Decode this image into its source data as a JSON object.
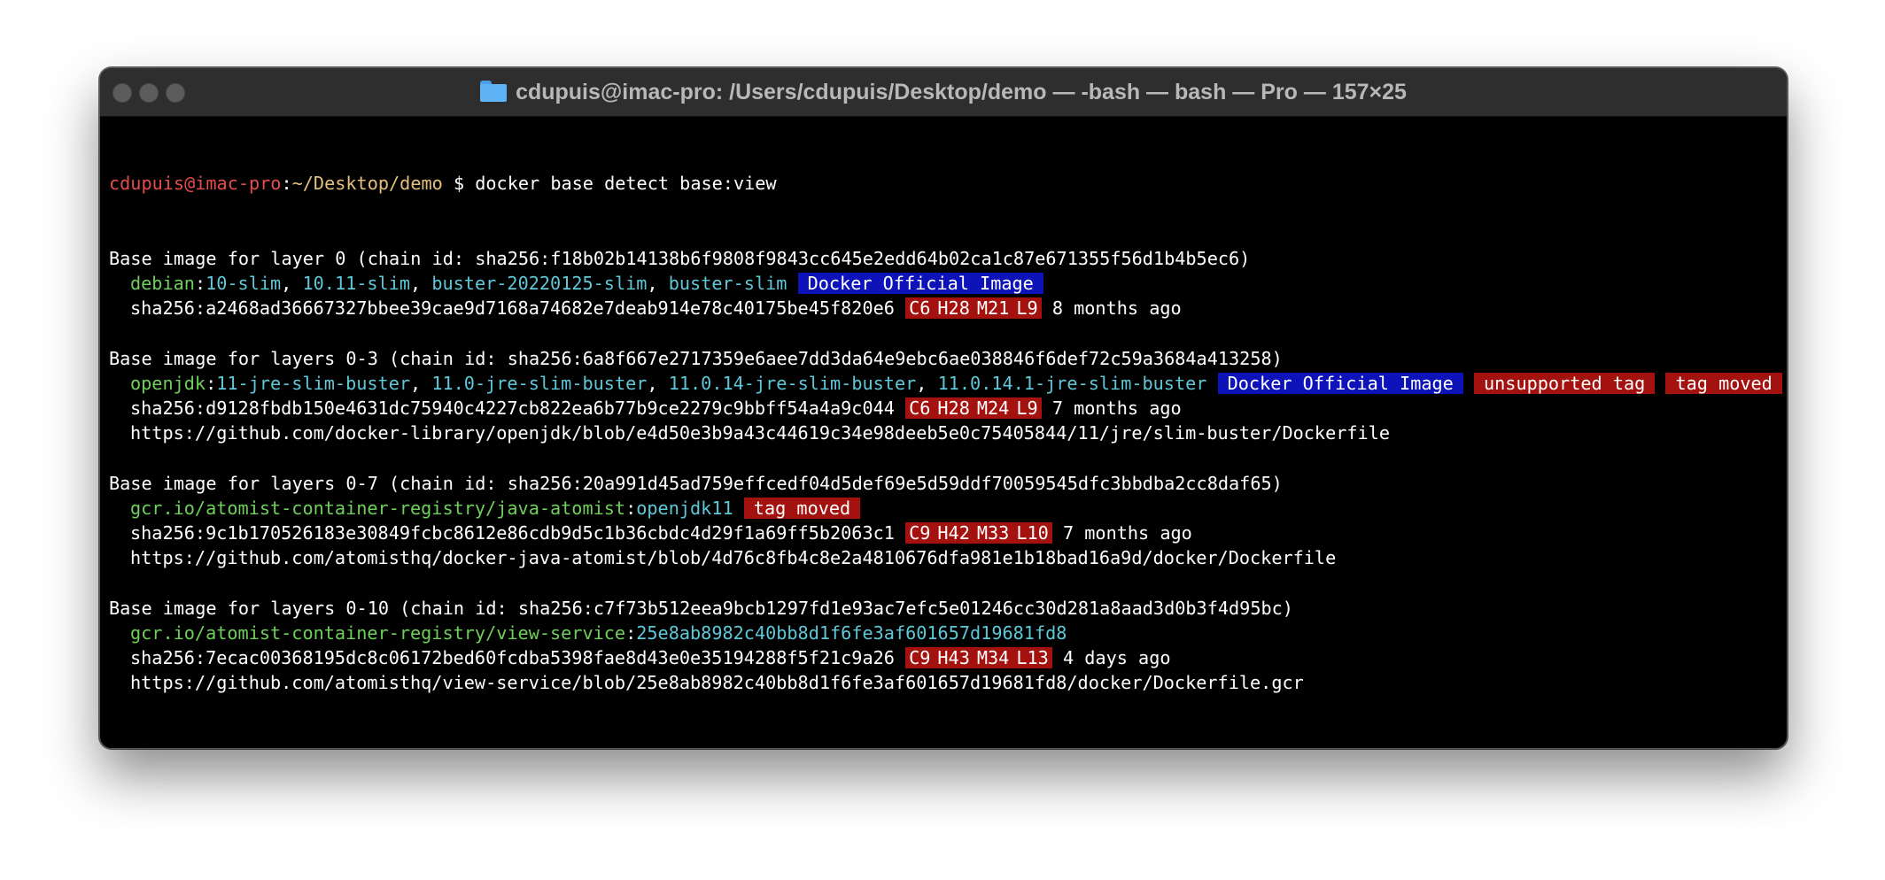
{
  "window": {
    "title": "cdupuis@imac-pro: /Users/cdupuis/Desktop/demo — -bash — bash — Pro — 157×25",
    "folder_icon": "folder-icon",
    "traffic_light_color": "#5c5c5c"
  },
  "prompt": {
    "user": "cdupuis@imac-pro",
    "path": "~/Desktop/demo",
    "symbol": "$",
    "command": "docker base detect base:view"
  },
  "blocks": [
    {
      "header": "Base image for layer 0 (chain id: sha256:f18b02b14138b6f9808f9843cc645e2edd64b02ca1c87e671355f56d1b4b5ec6)",
      "repo": "debian",
      "tags": [
        "10-slim",
        "10.11-slim",
        "buster-20220125-slim",
        "buster-slim"
      ],
      "badges": [
        {
          "label": "Docker Official Image",
          "type": "blue"
        }
      ],
      "digest": "sha256:a2468ad36667327bbee39cae9d7168a74682e7deab914e78c40175be45f820e6",
      "scores": [
        "C6",
        "H28",
        "M21",
        "L9"
      ],
      "age": "8 months ago",
      "url": ""
    },
    {
      "header": "Base image for layers 0-3 (chain id: sha256:6a8f667e2717359e6aee7dd3da64e9ebc6ae038846f6def72c59a3684a413258)",
      "repo": "openjdk",
      "tags": [
        "11-jre-slim-buster",
        "11.0-jre-slim-buster",
        "11.0.14-jre-slim-buster",
        "11.0.14.1-jre-slim-buster"
      ],
      "badges": [
        {
          "label": "Docker Official Image",
          "type": "blue"
        },
        {
          "label": "unsupported tag",
          "type": "red"
        },
        {
          "label": "tag moved",
          "type": "red"
        }
      ],
      "digest": "sha256:d9128fbdb150e4631dc75940c4227cb822ea6b77b9ce2279c9bbff54a4a9c044",
      "scores": [
        "C6",
        "H28",
        "M24",
        "L9"
      ],
      "age": "7 months ago",
      "url": "https://github.com/docker-library/openjdk/blob/e4d50e3b9a43c44619c34e98deeb5e0c75405844/11/jre/slim-buster/Dockerfile"
    },
    {
      "header": "Base image for layers 0-7 (chain id: sha256:20a991d45ad759effcedf04d5def69e5d59ddf70059545dfc3bbdba2cc8daf65)",
      "repo": "gcr.io/atomist-container-registry/java-atomist",
      "tags": [
        "openjdk11"
      ],
      "badges": [
        {
          "label": "tag moved",
          "type": "red"
        }
      ],
      "digest": "sha256:9c1b170526183e30849fcbc8612e86cdb9d5c1b36cbdc4d29f1a69ff5b2063c1",
      "scores": [
        "C9",
        "H42",
        "M33",
        "L10"
      ],
      "age": "7 months ago",
      "url": "https://github.com/atomisthq/docker-java-atomist/blob/4d76c8fb4c8e2a4810676dfa981e1b18bad16a9d/docker/Dockerfile"
    },
    {
      "header": "Base image for layers 0-10 (chain id: sha256:c7f73b512eea9bcb1297fd1e93ac7efc5e01246cc30d281a8aad3d0b3f4d95bc)",
      "repo": "gcr.io/atomist-container-registry/view-service",
      "tags": [
        "25e8ab8982c40bb8d1f6fe3af601657d19681fd8"
      ],
      "badges": [],
      "digest": "sha256:7ecac00368195dc8c06172bed60fcdba5398fae8d43e0e35194288f5f21c9a26",
      "scores": [
        "C9",
        "H43",
        "M34",
        "L13"
      ],
      "age": "4 days ago",
      "url": "https://github.com/atomisthq/view-service/blob/25e8ab8982c40bb8d1f6fe3af601657d19681fd8/docker/Dockerfile.gcr"
    }
  ],
  "colors": {
    "background": "#000000",
    "prompt_user": "#e34d4d",
    "prompt_path": "#e5c07b",
    "repo": "#6fcf5b",
    "tag": "#5fc8d8",
    "badge_blue": "#0d13b8",
    "badge_red": "#a4120f"
  }
}
